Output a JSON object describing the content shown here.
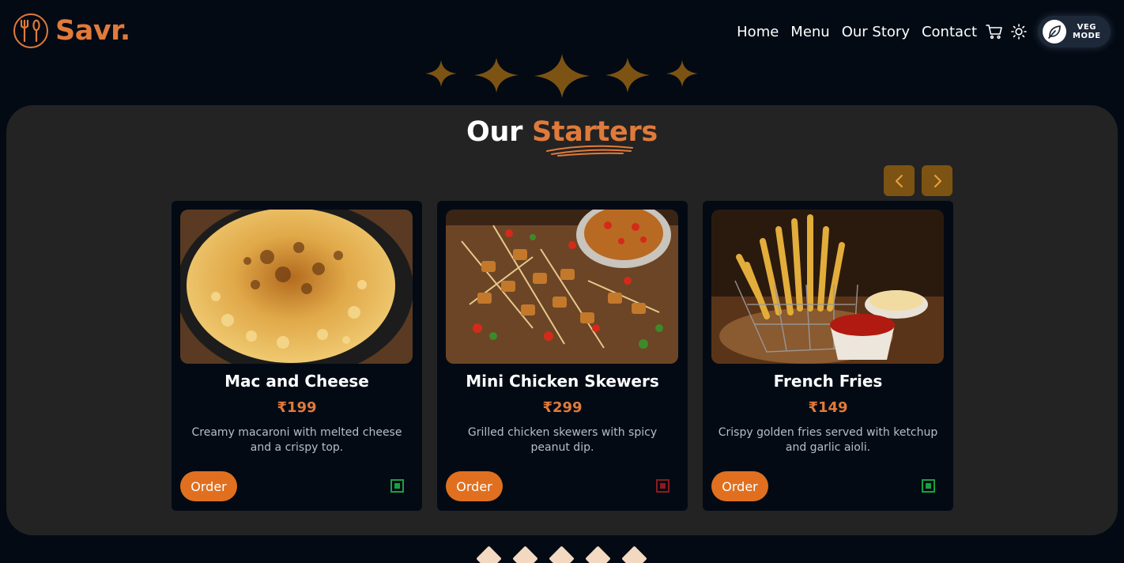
{
  "brand": {
    "name": "Savr.",
    "logo_icon": "cutlery-icon",
    "accent_color": "#e07a3b"
  },
  "nav": {
    "links": [
      "Home",
      "Menu",
      "Our Story",
      "Contact"
    ],
    "cart_icon": "cart-icon",
    "theme_icon": "sun-icon",
    "veg_mode": {
      "line1": "VEG",
      "line2": "MODE",
      "icon": "leaf-icon"
    }
  },
  "section": {
    "title_prefix": "Our",
    "title_accent": "Starters",
    "prev_icon": "chevron-left-icon",
    "next_icon": "chevron-right-icon"
  },
  "cards": [
    {
      "name": "Mac and Cheese",
      "price": "₹199",
      "description": "Creamy macaroni with melted cheese and a crispy top.",
      "order_label": "Order",
      "diet": "veg",
      "diet_color": "#18a040"
    },
    {
      "name": "Mini Chicken Skewers",
      "price": "₹299",
      "description": "Grilled chicken skewers with spicy peanut dip.",
      "order_label": "Order",
      "diet": "non-veg",
      "diet_color": "#8a1c1c"
    },
    {
      "name": "French Fries",
      "price": "₹149",
      "description": "Crispy golden fries served with ketchup and garlic aioli.",
      "order_label": "Order",
      "diet": "veg",
      "diet_color": "#18a040"
    }
  ],
  "colors": {
    "background": "#030a14",
    "panel": "#232323",
    "star": "#7c5313",
    "order_button": "#e0701f",
    "diamond": "#f3d9c2"
  }
}
